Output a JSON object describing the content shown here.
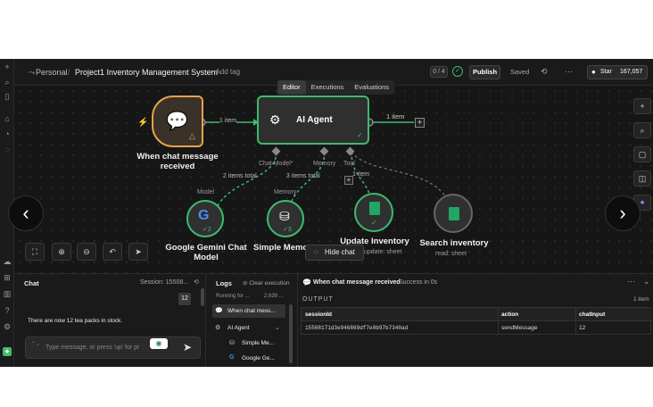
{
  "colors": {
    "accent_green": "#3dbb6e",
    "bg": "#141414",
    "trigger_orange": "#e7a24a"
  },
  "header": {
    "breadcrumb_personal": "Personal",
    "separator": "/",
    "project_title": "Project1 Inventory Management System",
    "add_tag": "+ Add tag",
    "exec_count": "0 / 4",
    "publish": "Publish",
    "saved": "Saved",
    "github_star": "Star",
    "star_count": "167,057"
  },
  "tabs": [
    "Editor",
    "Executions",
    "Evaluations"
  ],
  "canvas": {
    "trigger": {
      "label_line1": "When chat message",
      "label_line2": "received"
    },
    "edge1_label": "1 item",
    "agent": {
      "label": "AI Agent"
    },
    "agent_out_label": "1 item",
    "ports": {
      "chat_model": "Chat Model",
      "required": "*",
      "memory": "Memory",
      "tool": "Tool"
    },
    "tool_edge_label": "1 item",
    "edge_chat_label": "2 items total",
    "edge_memory_label": "3 items total",
    "model_caption": "Model",
    "memory_caption": "Memory",
    "gemini": {
      "label_line1": "Google Gemini Chat",
      "label_line2": "Model",
      "badge": "2"
    },
    "memory_node": {
      "label": "Simple Memo",
      "badge": "3"
    },
    "update": {
      "label": "Update Inventory",
      "sub": "update: sheet"
    },
    "search": {
      "label": "Search inventory",
      "sub": "read: sheet"
    },
    "hide_chat": "Hide chat"
  },
  "chat_panel": {
    "title": "Chat",
    "session": "Session: 15508...",
    "bubble_value": "12",
    "message": "There are now 12 tea packs in stock.",
    "input_placeholder": "Type message, or press 'up' for pr"
  },
  "logs_panel": {
    "title": "Logs",
    "clear": "Clear execution",
    "running": "Running for ...",
    "tokens": "2,639 ...",
    "items": [
      "When chat mess...",
      "AI Agent",
      "Simple Me...",
      "Google Ge..."
    ]
  },
  "output_panel": {
    "node_title": "When chat message received",
    "status": "Success in 0s",
    "output_label": "OUTPUT",
    "item_count": "1 item",
    "columns": [
      "sessionId",
      "action",
      "chatInput"
    ],
    "rows": [
      [
        "15508171d3e946869df7e0b97b7340ad",
        "sendMessage",
        "12"
      ]
    ]
  }
}
